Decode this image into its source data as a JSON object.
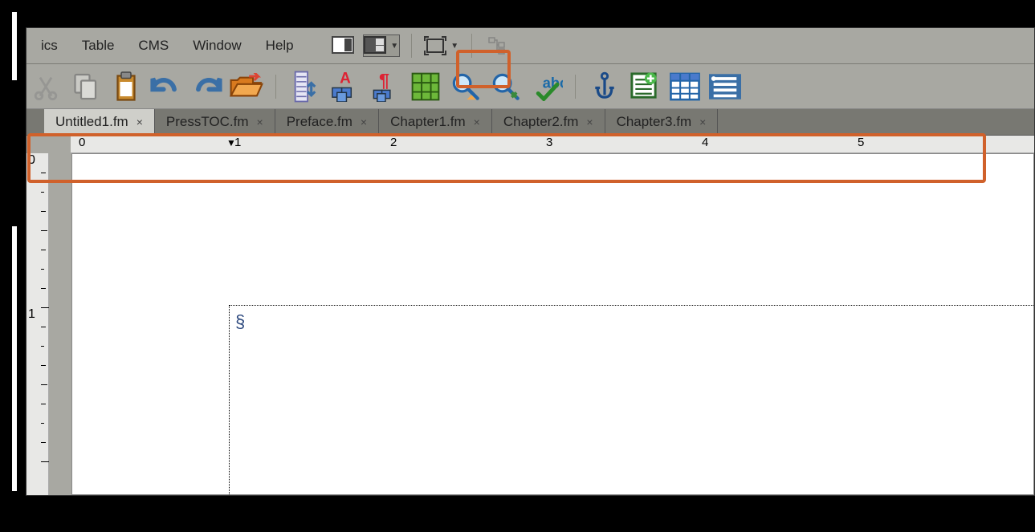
{
  "menu": {
    "items": [
      "ics",
      "Table",
      "CMS",
      "Window",
      "Help"
    ]
  },
  "tabs": [
    {
      "label": "Untitled1.fm",
      "active": true
    },
    {
      "label": "PressTOC.fm",
      "active": false
    },
    {
      "label": "Preface.fm",
      "active": false
    },
    {
      "label": "Chapter1.fm",
      "active": false
    },
    {
      "label": "Chapter2.fm",
      "active": false
    },
    {
      "label": "Chapter3.fm",
      "active": false
    }
  ],
  "ruler_h": [
    "0",
    "1",
    "2",
    "3",
    "4",
    "5"
  ],
  "ruler_v": [
    "0",
    "1"
  ],
  "paragraph_mark": "§"
}
